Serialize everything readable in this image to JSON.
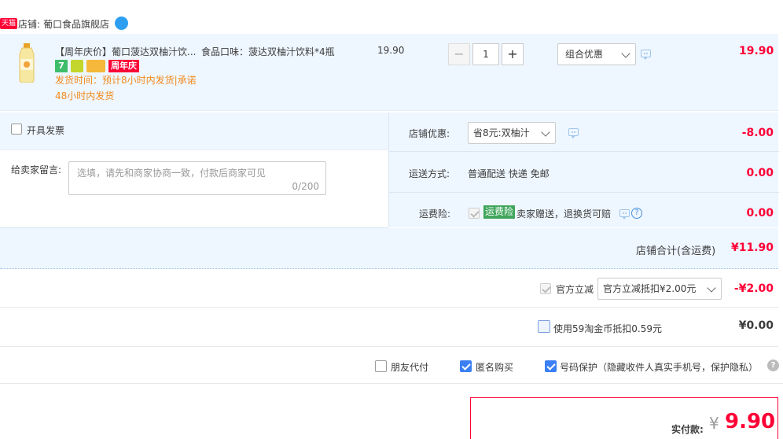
{
  "shop": {
    "badge": "天猫",
    "prefix": "店铺:",
    "name": "葡口食品旗舰店"
  },
  "item": {
    "title": "【周年庆价】葡口菠达双柚汁饮...",
    "spec": "食品口味：菠达双柚汁饮料*4瓶",
    "price": "19.90",
    "quantity": "1",
    "minus": "−",
    "plus": "+",
    "promo_select": "组合优惠",
    "subtotal": "19.90",
    "anniversary_badge": "周年庆",
    "delivery_note": "发货时间：预计8小时内发货|承诺48小时内发货",
    "badge_seven": "7"
  },
  "invoice": {
    "label": "开具发票"
  },
  "message": {
    "label": "给卖家留言:",
    "placeholder": "选填，请先和商家协商一致，付款后商家可见",
    "counter": "0/200"
  },
  "store_discount": {
    "label": "店铺优惠:",
    "selected": "省8元:双柚汁",
    "amount": "-8.00"
  },
  "shipping": {
    "label": "运送方式:",
    "value": "普通配送 快递 免邮",
    "amount": "0.00"
  },
  "insurance": {
    "label": "运费险:",
    "badge": "运费险",
    "value": "卖家赠送，退换货可赔",
    "amount": "0.00"
  },
  "shop_total": {
    "label": "店铺合计(含运费)",
    "amount": "¥11.90"
  },
  "official_discount": {
    "label": "官方立减",
    "selected": "官方立减抵扣¥2.00元",
    "amount": "-¥2.00"
  },
  "taobao_coin": {
    "label": "使用59淘金币抵扣0.59元",
    "amount": "¥0.00"
  },
  "options": {
    "friend_pay": "朋友代付",
    "anonymous": "匿名购买",
    "number_protect": "号码保护（隐藏收件人真实手机号，保护隐私）",
    "help_glyph": "?"
  },
  "payment": {
    "label": "实付款:",
    "currency": "¥",
    "amount": "9.90"
  },
  "colors": {
    "accent_red": "#ff0036",
    "highlight_bg": "#eef6ff",
    "checkbox_blue": "#3b7ff4",
    "delivery_orange": "#f28a1c"
  }
}
